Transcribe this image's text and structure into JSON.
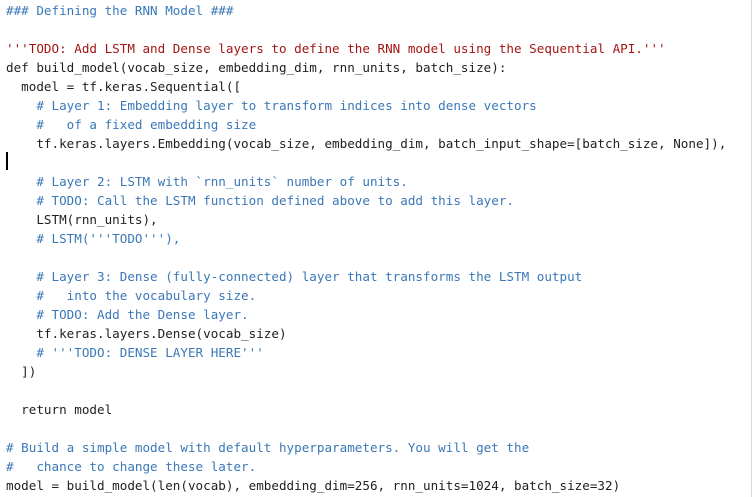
{
  "editor": {
    "lines": [
      {
        "text": "### Defining the RNN Model ###",
        "kind": "comment"
      },
      {
        "text": "",
        "kind": "normal"
      },
      {
        "text": "'''TODO: Add LSTM and Dense layers to define the RNN model using the Sequential API.'''",
        "kind": "string"
      },
      {
        "text": "def build_model(vocab_size, embedding_dim, rnn_units, batch_size):",
        "kind": "normal"
      },
      {
        "text": "  model = tf.keras.Sequential([",
        "kind": "normal"
      },
      {
        "text": "    # Layer 1: Embedding layer to transform indices into dense vectors",
        "kind": "comment"
      },
      {
        "text": "    #   of a fixed embedding size",
        "kind": "comment"
      },
      {
        "text": "    tf.keras.layers.Embedding(vocab_size, embedding_dim, batch_input_shape=[batch_size, None]),",
        "kind": "normal"
      },
      {
        "text": "",
        "kind": "normal"
      },
      {
        "text": "    # Layer 2: LSTM with `rnn_units` number of units.",
        "kind": "comment"
      },
      {
        "text": "    # TODO: Call the LSTM function defined above to add this layer.",
        "kind": "comment"
      },
      {
        "text": "    LSTM(rnn_units),",
        "kind": "normal"
      },
      {
        "text": "    # LSTM('''TODO'''),",
        "kind": "comment"
      },
      {
        "text": "",
        "kind": "normal"
      },
      {
        "text": "    # Layer 3: Dense (fully-connected) layer that transforms the LSTM output",
        "kind": "comment"
      },
      {
        "text": "    #   into the vocabulary size.",
        "kind": "comment"
      },
      {
        "text": "    # TODO: Add the Dense layer.",
        "kind": "comment"
      },
      {
        "text": "    tf.keras.layers.Dense(vocab_size)",
        "kind": "normal"
      },
      {
        "text": "    # '''TODO: DENSE LAYER HERE'''",
        "kind": "comment"
      },
      {
        "text": "  ])",
        "kind": "normal"
      },
      {
        "text": "",
        "kind": "normal"
      },
      {
        "text": "  return model",
        "kind": "normal"
      },
      {
        "text": "",
        "kind": "normal"
      },
      {
        "text": "# Build a simple model with default hyperparameters. You will get the",
        "kind": "comment"
      },
      {
        "text": "#   chance to change these later.",
        "kind": "comment"
      },
      {
        "text": "model = build_model(len(vocab), embedding_dim=256, rnn_units=1024, batch_size=32)",
        "kind": "normal"
      }
    ]
  },
  "colors": {
    "comment": "#3b78b8",
    "string": "#a31515",
    "normal": "#1f1f1f",
    "background": "#ffffff"
  }
}
